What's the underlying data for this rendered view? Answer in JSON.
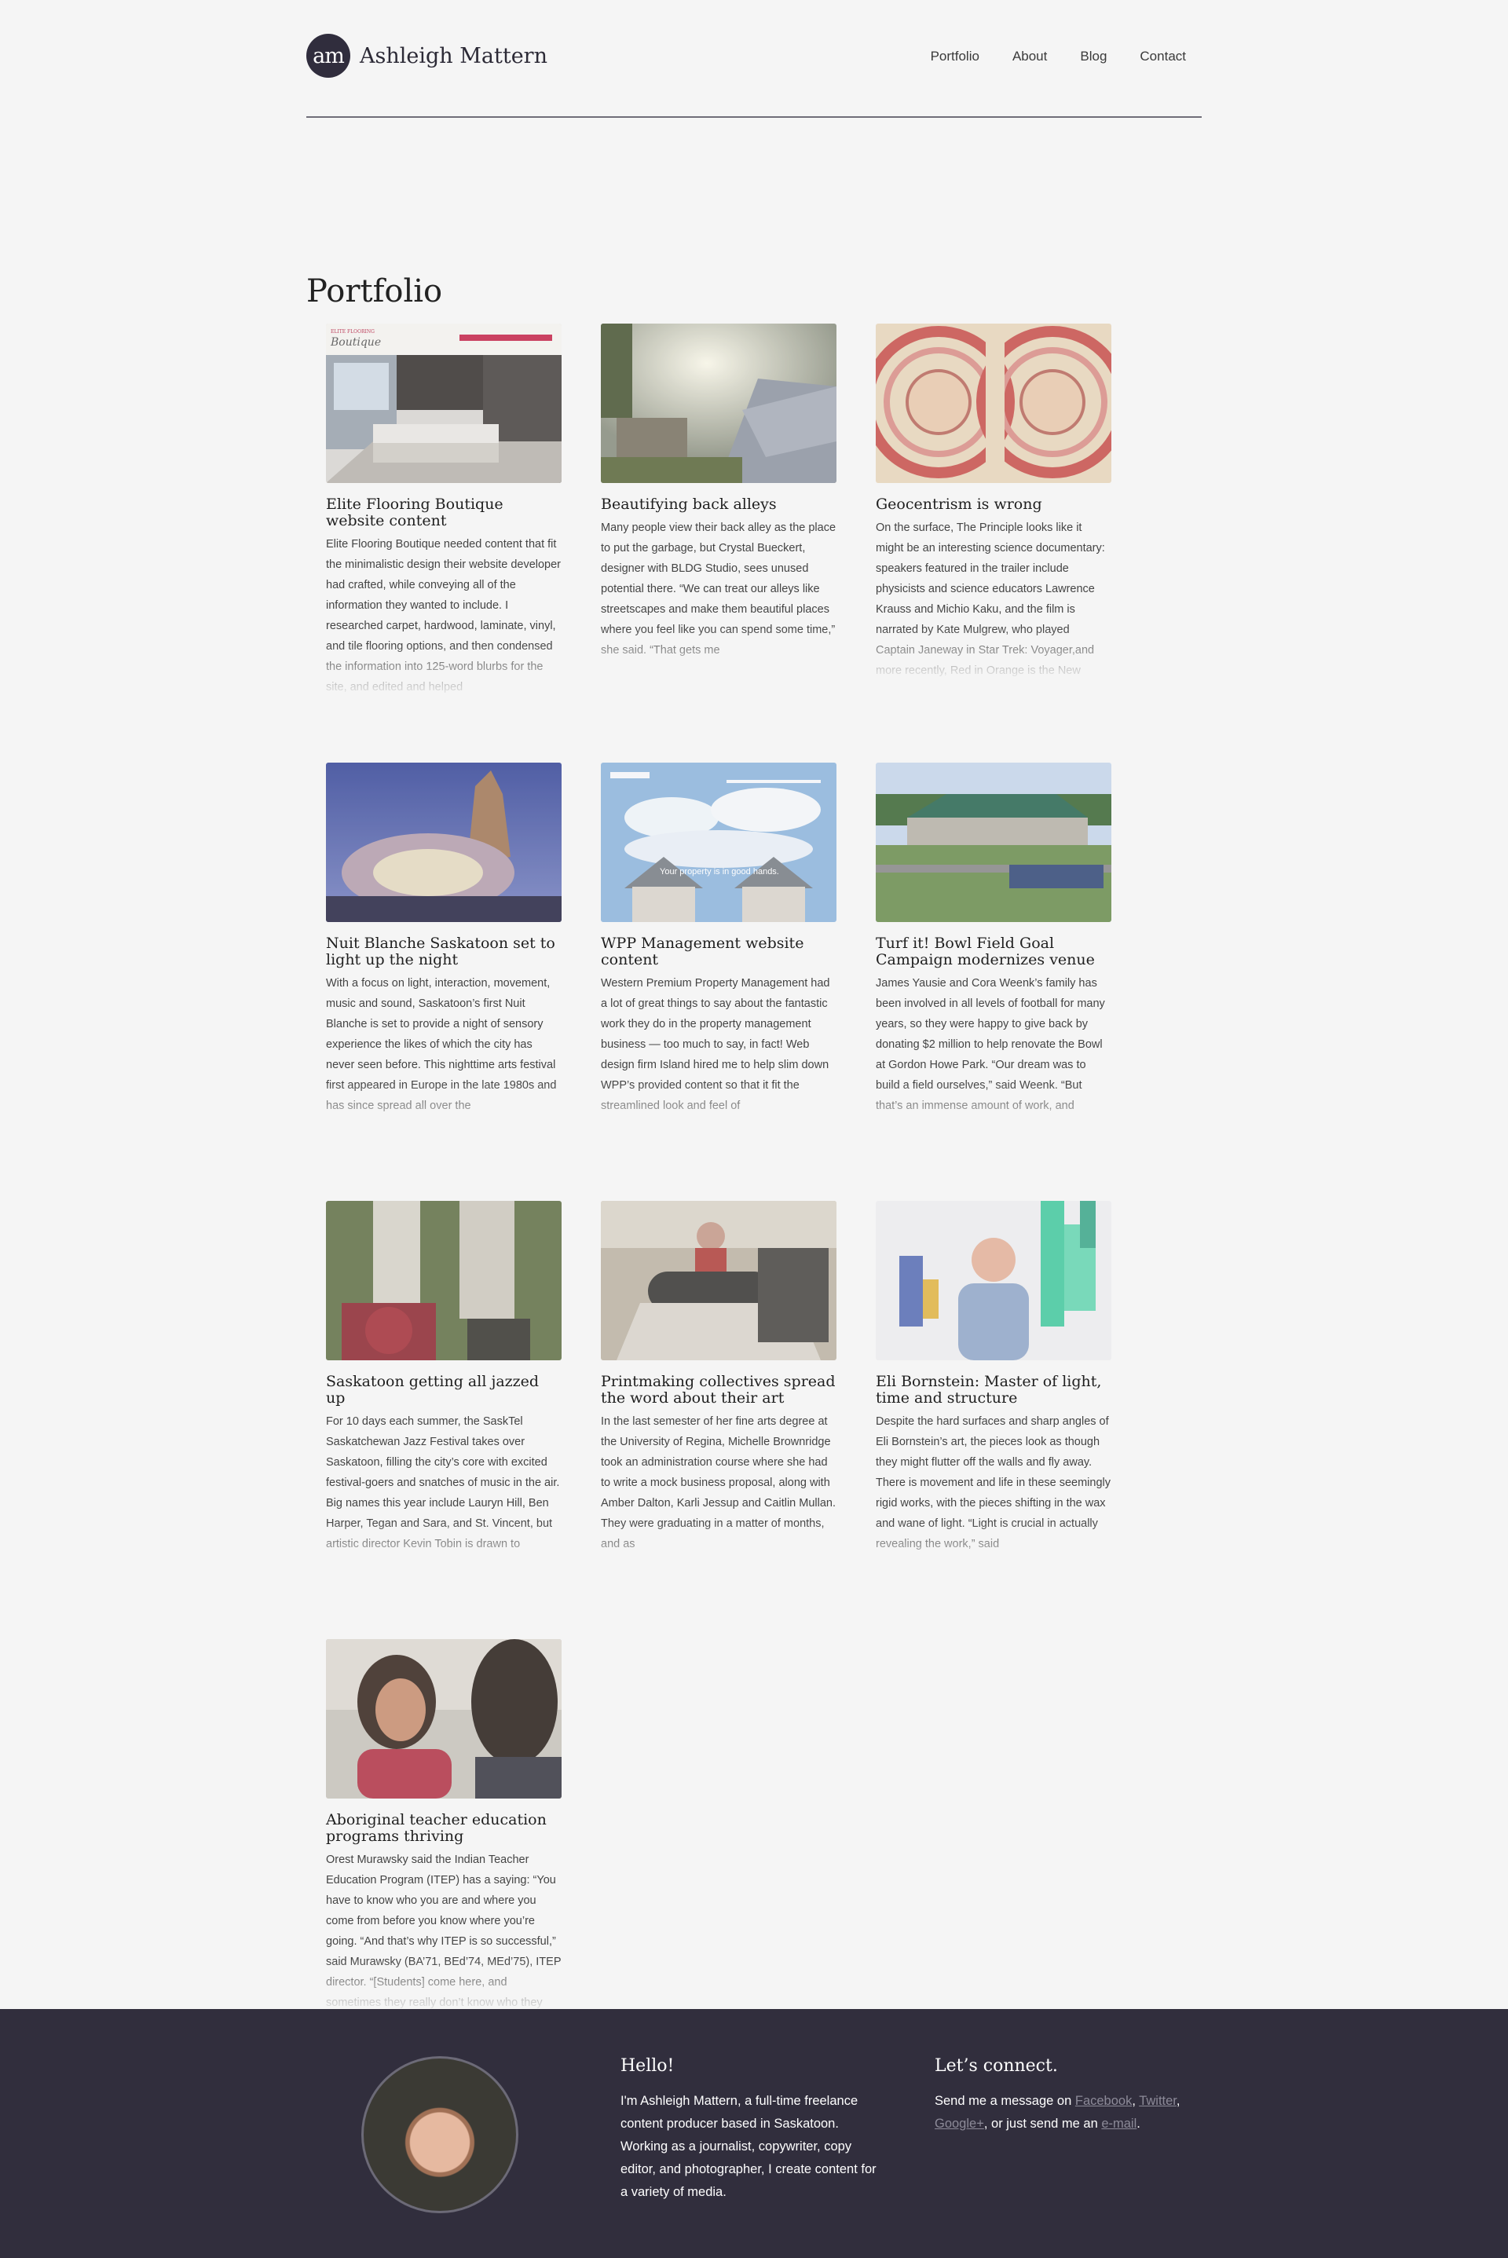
{
  "header": {
    "logo_initials": "am",
    "site_name": "Ashleigh Mattern",
    "nav": [
      "Portfolio",
      "About",
      "Blog",
      "Contact"
    ]
  },
  "page_title": "Portfolio",
  "cards": [
    {
      "title": "Elite Flooring Boutique website content",
      "excerpt": "Elite Flooring Boutique needed content that fit the minimalistic design their website developer had crafted, while conveying all of the information they wanted to include. I researched carpet, hardwood, laminate, vinyl, and tile flooring options, and then condensed the information into 125-word blurbs for the site, and edited and helped"
    },
    {
      "title": "Beautifying back alleys",
      "excerpt": "Many people view their back alley as the place to put the garbage, but Crystal Bueckert, designer with BLDG Studio, sees unused potential there. “We can treat our alleys like streetscapes and make them beautiful places where you feel like you can spend some time,” she said. “That gets me"
    },
    {
      "title": "Geocentrism is wrong",
      "excerpt": "On the surface, The Principle looks like it might be an interesting science documentary: speakers featured in the trailer include physicists and science educators Lawrence Krauss and Michio Kaku, and the film is narrated by Kate Mulgrew, who played Captain Janeway in Star Trek: Voyager,and more recently, Red in Orange is the New Black. But not far"
    },
    {
      "title": "Nuit Blanche Saskatoon set to light up the night",
      "excerpt": "With a focus on light, interaction, movement, music and sound, Saskatoon’s first Nuit Blanche is set to provide a night of sensory experience the likes of which the city has never seen before. This nighttime arts festival first appeared in Europe in the late 1980s and has since spread all over the"
    },
    {
      "title": "WPP Management website content",
      "excerpt": "Western Premium Property Management had a lot of great things to say about the fantastic work they do in the property management business — too much to say, in fact! Web design firm Island hired me to help slim down WPP’s provided content so that it fit the streamlined look and feel of"
    },
    {
      "title": "Turf it! Bowl Field Goal Campaign modernizes venue",
      "excerpt": "James Yausie and Cora Weenk’s family has been involved in all levels of football for many years, so they were happy to give back by donating $2 million to help renovate the Bowl at Gordon Howe Park. “Our dream was to build a field ourselves,” said Weenk. “But that’s an immense amount of work, and"
    },
    {
      "title": "Saskatoon getting all jazzed up",
      "excerpt": "For 10 days each summer, the SaskTel Saskatchewan Jazz Festival takes over Saskatoon, filling the city’s core with excited festival-goers and snatches of music in the air. Big names this year include Lauryn Hill, Ben Harper, Tegan and Sara, and St. Vincent, but artistic director Kevin Tobin is drawn to"
    },
    {
      "title": "Printmaking collectives spread the word about their art",
      "excerpt": "In the last semester of her fine arts degree at the University of Regina, Michelle Brownridge took an administration course where she had to write a mock business proposal, along with Amber Dalton, Karli Jessup and Caitlin Mullan. They were graduating in a matter of months, and as"
    },
    {
      "title": "Eli Bornstein: Master of light, time and structure",
      "excerpt": "Despite the hard surfaces and sharp angles of Eli Bornstein’s art, the pieces look as though they might flutter off the walls and fly away. There is movement and life in these seemingly rigid works, with the pieces shifting in the wax and wane of light. “Light is crucial in actually revealing the work,” said"
    },
    {
      "title": "Aboriginal teacher education programs thriving",
      "excerpt": "Orest Murawsky said the Indian Teacher Education Program (ITEP) has a saying: “You have to know who you are and where you come from before you know where you’re going. “And that’s why ITEP is so successful,” said Murawsky (BA’71, BEd’74, MEd’75), ITEP director. “[Students] come here, and sometimes they really don’t know who they"
    }
  ],
  "thumb_text": {
    "wpp_banner": "Your property is in good hands."
  },
  "footer": {
    "hello_title": "Hello!",
    "hello_text": "I'm Ashleigh Mattern, a full-time freelance content producer based in Saskatoon. Working as a journalist, copywriter, copy editor, and photographer, I create content for a variety of media.",
    "connect_title": "Let’s connect.",
    "connect_prefix": "Send me a message on ",
    "facebook": "Facebook",
    "twitter": "Twitter",
    "googleplus": "Google+",
    "connect_mid": ", or just send me an ",
    "email": "e-mail",
    "connect_end": "."
  },
  "colors": {
    "footer_bg": "#312e3d",
    "logo_bg": "#302d3d",
    "page_bg": "#f5f5f5"
  }
}
